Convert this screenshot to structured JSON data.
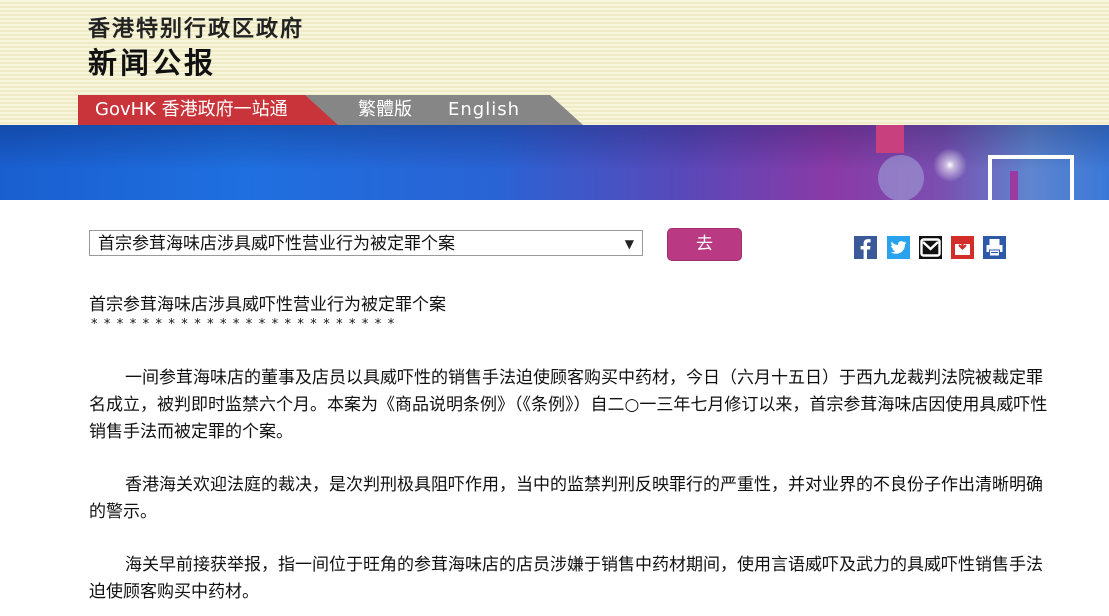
{
  "header": {
    "gov_title": "香港特别行政区政府",
    "press_title": "新闻公报"
  },
  "tabs": {
    "govhk": "GovHK 香港政府一站通",
    "traditional": "繁體版",
    "english": "English"
  },
  "toolbar": {
    "selected_article": "首宗参茸海味店涉具威吓性营业行为被定罪个案",
    "go_label": "去"
  },
  "share": {
    "facebook_icon": "facebook-icon",
    "twitter_icon": "twitter-icon",
    "email_icon": "email-icon",
    "save_icon": "save-icon",
    "print_icon": "print-icon"
  },
  "article": {
    "title": "首宗参茸海味店涉具威吓性营业行为被定罪个案",
    "stars": "************************",
    "paragraphs": [
      "一间参茸海味店的董事及店员以具威吓性的销售手法迫使顾客购买中药材，今日（六月十五日）于西九龙裁判法院被裁定罪名成立，被判即时监禁六个月。本案为《商品说明条例》（《条例》）自二○一三年七月修订以来，首宗参茸海味店因使用具威吓性销售手法而被定罪的个案。",
      "香港海关欢迎法庭的裁决，是次判刑极具阻吓作用，当中的监禁判刑反映罪行的严重性，并对业界的不良份子作出清晰明确的警示。",
      "海关早前接获举报，指一间位于旺角的参茸海味店的店员涉嫌于销售中药材期间，使用言语威吓及武力的具威吓性销售手法迫使顾客购买中药材。"
    ]
  },
  "colors": {
    "govhk_tab": "#c8343a",
    "lang_tab": "#868686",
    "go_button": "#b93a82",
    "header_bg": "#f3f1d2"
  }
}
